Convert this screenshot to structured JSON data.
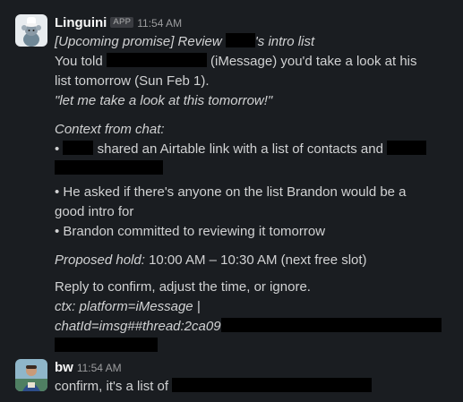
{
  "messages": [
    {
      "sender": "Linguini",
      "badge": "APP",
      "time": "11:54 AM",
      "title_part1": "[Upcoming promise] Review",
      "title_part2": "'s intro list",
      "you_told": "You told",
      "imessage_part": "(iMessage) you'd take a look at his",
      "list_tomorrow": "list tomorrow (Sun Feb 1).",
      "quote": "\"let me take a look at this tomorrow!\"",
      "context_heading": "Context from chat:",
      "bullet1_part": "shared an Airtable link with a list of contacts and",
      "bullet2_line1": "• He asked if there's anyone on the list Brandon would be a",
      "bullet2_line2": "good intro for",
      "bullet3": "• Brandon committed to reviewing it tomorrow",
      "proposed_label": "Proposed hold:",
      "proposed_value": "10:00 AM – 10:30 AM (next free slot)",
      "reply_text": "Reply to confirm, adjust the time, or ignore.",
      "ctx_line1": "ctx: platform=iMessage |",
      "ctx_line2": "chatId=imsg##thread:2ca09",
      "bullet_char": "•"
    },
    {
      "sender": "bw",
      "time": "11:54 AM",
      "text": "confirm, it's a list of"
    }
  ]
}
